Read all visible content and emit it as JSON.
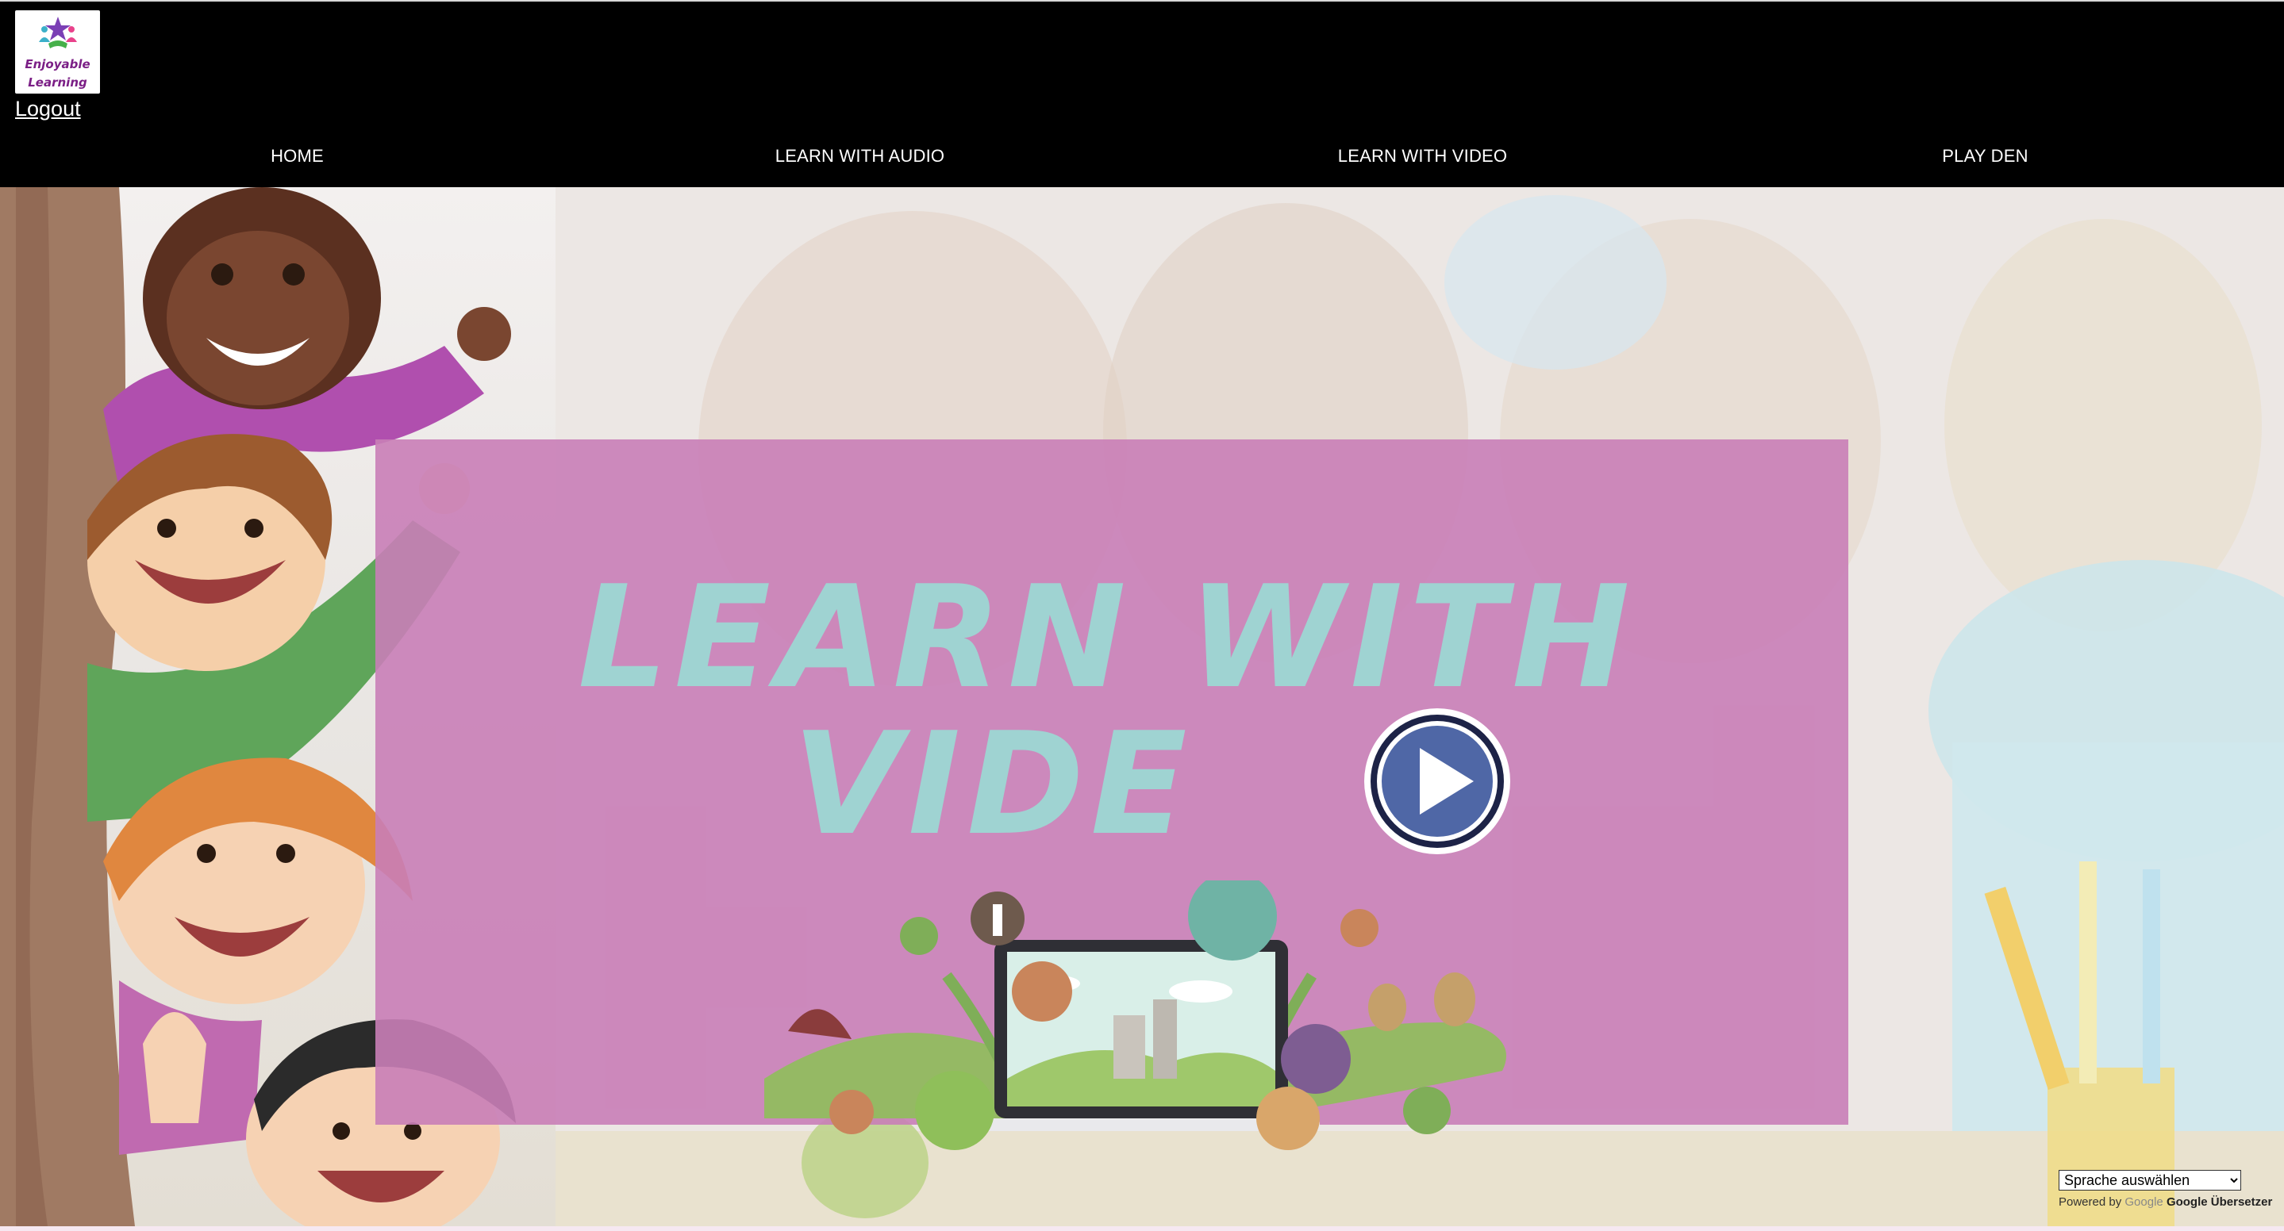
{
  "logo": {
    "line1": "Enjoyable",
    "line2": "Learning"
  },
  "header": {
    "logout_label": "Logout"
  },
  "nav": {
    "items": [
      {
        "label": "HOME"
      },
      {
        "label": "LEARN WITH AUDIO"
      },
      {
        "label": "LEARN WITH VIDEO"
      },
      {
        "label": "PLAY DEN"
      }
    ]
  },
  "hero": {
    "banner": {
      "title_line1": "LEARN WITH",
      "title_line2": "VIDE"
    }
  },
  "translate": {
    "select_value": "Sprache auswählen",
    "powered_by": "Powered by",
    "google": "Google",
    "service": "Google Übersetzer"
  },
  "colors": {
    "header_bg": "#000000",
    "banner_bg": "#c97eb7",
    "title_text": "#9fd3d2",
    "play_button": "#4f67a6"
  }
}
